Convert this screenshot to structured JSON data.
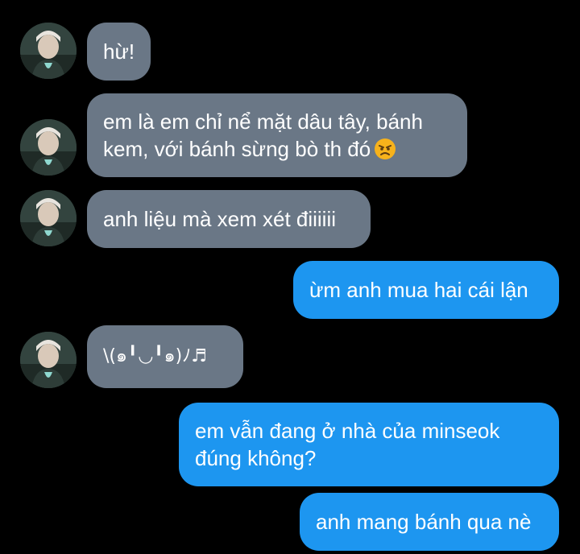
{
  "conversation": {
    "messages": [
      {
        "side": "incoming",
        "text": "hừ!"
      },
      {
        "side": "incoming",
        "line1": "em là em chỉ nể mặt dâu tây, bánh",
        "line2": "kem, với bánh sừng bò th đó",
        "emoji": "angry-face-icon"
      },
      {
        "side": "incoming",
        "text": "anh liệu mà xem xét điiiiii"
      },
      {
        "side": "outgoing",
        "text": "ừm anh mua hai cái lận"
      },
      {
        "side": "incoming",
        "text": "\\(๑╹◡╹๑)ﾉ♬"
      },
      {
        "side": "outgoing",
        "line1": "em vẫn đang ở nhà của minseok",
        "line2": "đúng không?"
      },
      {
        "side": "outgoing",
        "text": "anh mang bánh qua nè"
      }
    ]
  },
  "colors": {
    "background": "#000000",
    "incoming_bubble": "#6a7786",
    "outgoing_bubble": "#1d96f0",
    "text": "#ffffff"
  },
  "icons": [
    "avatar",
    "angry-face-icon"
  ]
}
